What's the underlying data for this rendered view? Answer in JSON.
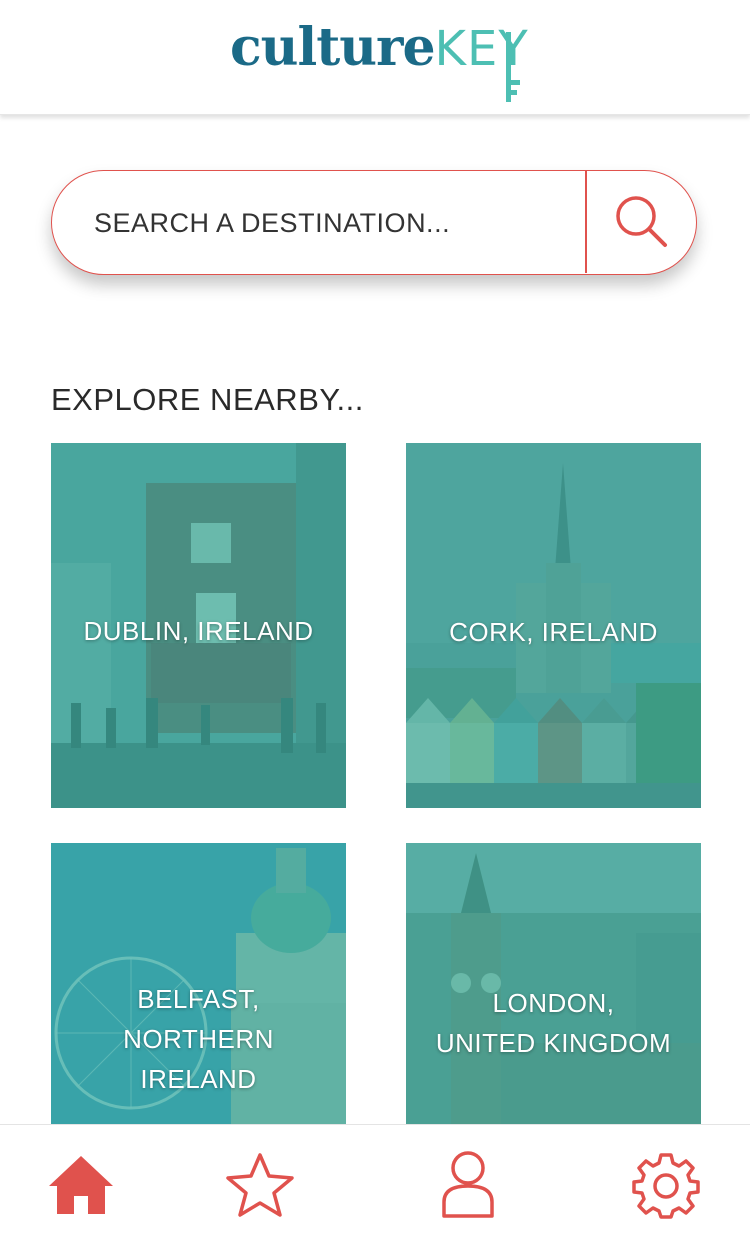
{
  "app": {
    "logo_primary": "culture",
    "logo_secondary": "KEY",
    "brand_colors": {
      "primary": "#1b6a87",
      "secondary": "#4dbfb3",
      "accent": "#e0524d"
    }
  },
  "search": {
    "placeholder": "SEARCH A DESTINATION...",
    "value": "",
    "button_icon": "search-icon"
  },
  "explore": {
    "title": "EXPLORE NEARBY...",
    "cards": [
      {
        "line1": "DUBLIN, IRELAND",
        "line2": "",
        "line3": ""
      },
      {
        "line1": "CORK, IRELAND",
        "line2": "",
        "line3": ""
      },
      {
        "line1": "BELFAST,",
        "line2": "NORTHERN",
        "line3": "IRELAND"
      },
      {
        "line1": "LONDON,",
        "line2": "UNITED KINGDOM",
        "line3": ""
      }
    ]
  },
  "tabs": [
    {
      "icon": "home-icon",
      "active": true
    },
    {
      "icon": "star-icon",
      "active": false
    },
    {
      "icon": "user-icon",
      "active": false
    },
    {
      "icon": "gear-icon",
      "active": false
    }
  ]
}
